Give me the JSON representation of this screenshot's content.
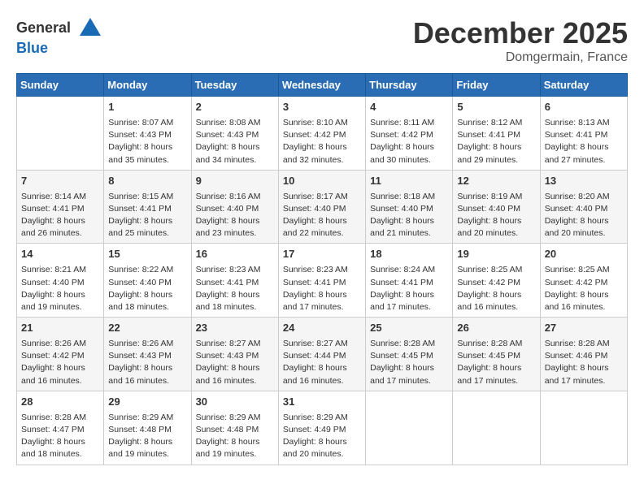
{
  "header": {
    "logo_line1": "General",
    "logo_line2": "Blue",
    "month_title": "December 2025",
    "location": "Domgermain, France"
  },
  "weekdays": [
    "Sunday",
    "Monday",
    "Tuesday",
    "Wednesday",
    "Thursday",
    "Friday",
    "Saturday"
  ],
  "weeks": [
    [
      {
        "day": "",
        "empty": true
      },
      {
        "day": "1",
        "sunrise": "8:07 AM",
        "sunset": "4:43 PM",
        "daylight": "8 hours and 35 minutes."
      },
      {
        "day": "2",
        "sunrise": "8:08 AM",
        "sunset": "4:43 PM",
        "daylight": "8 hours and 34 minutes."
      },
      {
        "day": "3",
        "sunrise": "8:10 AM",
        "sunset": "4:42 PM",
        "daylight": "8 hours and 32 minutes."
      },
      {
        "day": "4",
        "sunrise": "8:11 AM",
        "sunset": "4:42 PM",
        "daylight": "8 hours and 30 minutes."
      },
      {
        "day": "5",
        "sunrise": "8:12 AM",
        "sunset": "4:41 PM",
        "daylight": "8 hours and 29 minutes."
      },
      {
        "day": "6",
        "sunrise": "8:13 AM",
        "sunset": "4:41 PM",
        "daylight": "8 hours and 27 minutes."
      }
    ],
    [
      {
        "day": "7",
        "sunrise": "8:14 AM",
        "sunset": "4:41 PM",
        "daylight": "8 hours and 26 minutes."
      },
      {
        "day": "8",
        "sunrise": "8:15 AM",
        "sunset": "4:41 PM",
        "daylight": "8 hours and 25 minutes."
      },
      {
        "day": "9",
        "sunrise": "8:16 AM",
        "sunset": "4:40 PM",
        "daylight": "8 hours and 23 minutes."
      },
      {
        "day": "10",
        "sunrise": "8:17 AM",
        "sunset": "4:40 PM",
        "daylight": "8 hours and 22 minutes."
      },
      {
        "day": "11",
        "sunrise": "8:18 AM",
        "sunset": "4:40 PM",
        "daylight": "8 hours and 21 minutes."
      },
      {
        "day": "12",
        "sunrise": "8:19 AM",
        "sunset": "4:40 PM",
        "daylight": "8 hours and 20 minutes."
      },
      {
        "day": "13",
        "sunrise": "8:20 AM",
        "sunset": "4:40 PM",
        "daylight": "8 hours and 20 minutes."
      }
    ],
    [
      {
        "day": "14",
        "sunrise": "8:21 AM",
        "sunset": "4:40 PM",
        "daylight": "8 hours and 19 minutes."
      },
      {
        "day": "15",
        "sunrise": "8:22 AM",
        "sunset": "4:40 PM",
        "daylight": "8 hours and 18 minutes."
      },
      {
        "day": "16",
        "sunrise": "8:23 AM",
        "sunset": "4:41 PM",
        "daylight": "8 hours and 18 minutes."
      },
      {
        "day": "17",
        "sunrise": "8:23 AM",
        "sunset": "4:41 PM",
        "daylight": "8 hours and 17 minutes."
      },
      {
        "day": "18",
        "sunrise": "8:24 AM",
        "sunset": "4:41 PM",
        "daylight": "8 hours and 17 minutes."
      },
      {
        "day": "19",
        "sunrise": "8:25 AM",
        "sunset": "4:42 PM",
        "daylight": "8 hours and 16 minutes."
      },
      {
        "day": "20",
        "sunrise": "8:25 AM",
        "sunset": "4:42 PM",
        "daylight": "8 hours and 16 minutes."
      }
    ],
    [
      {
        "day": "21",
        "sunrise": "8:26 AM",
        "sunset": "4:42 PM",
        "daylight": "8 hours and 16 minutes."
      },
      {
        "day": "22",
        "sunrise": "8:26 AM",
        "sunset": "4:43 PM",
        "daylight": "8 hours and 16 minutes."
      },
      {
        "day": "23",
        "sunrise": "8:27 AM",
        "sunset": "4:43 PM",
        "daylight": "8 hours and 16 minutes."
      },
      {
        "day": "24",
        "sunrise": "8:27 AM",
        "sunset": "4:44 PM",
        "daylight": "8 hours and 16 minutes."
      },
      {
        "day": "25",
        "sunrise": "8:28 AM",
        "sunset": "4:45 PM",
        "daylight": "8 hours and 17 minutes."
      },
      {
        "day": "26",
        "sunrise": "8:28 AM",
        "sunset": "4:45 PM",
        "daylight": "8 hours and 17 minutes."
      },
      {
        "day": "27",
        "sunrise": "8:28 AM",
        "sunset": "4:46 PM",
        "daylight": "8 hours and 17 minutes."
      }
    ],
    [
      {
        "day": "28",
        "sunrise": "8:28 AM",
        "sunset": "4:47 PM",
        "daylight": "8 hours and 18 minutes."
      },
      {
        "day": "29",
        "sunrise": "8:29 AM",
        "sunset": "4:48 PM",
        "daylight": "8 hours and 19 minutes."
      },
      {
        "day": "30",
        "sunrise": "8:29 AM",
        "sunset": "4:48 PM",
        "daylight": "8 hours and 19 minutes."
      },
      {
        "day": "31",
        "sunrise": "8:29 AM",
        "sunset": "4:49 PM",
        "daylight": "8 hours and 20 minutes."
      },
      {
        "day": "",
        "empty": true
      },
      {
        "day": "",
        "empty": true
      },
      {
        "day": "",
        "empty": true
      }
    ]
  ]
}
